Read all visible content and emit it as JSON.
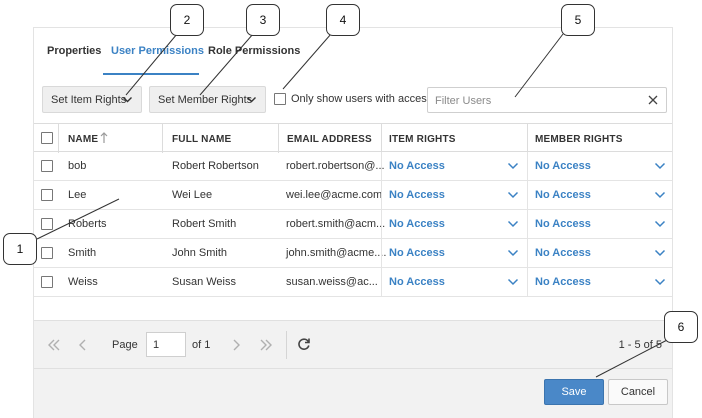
{
  "tabs": [
    {
      "label": "Properties"
    },
    {
      "label": "User Permissions"
    },
    {
      "label": "Role Permissions"
    }
  ],
  "toolbar": {
    "set_item_rights": "Set Item Rights",
    "set_member_rights": "Set Member Rights",
    "only_show_label": "Only show users with access",
    "filter_placeholder": "Filter Users"
  },
  "columns": {
    "name": "NAME",
    "full_name": "FULL NAME",
    "email": "EMAIL ADDRESS",
    "item_rights": "ITEM RIGHTS",
    "member_rights": "MEMBER RIGHTS"
  },
  "rows": [
    {
      "name": "bob",
      "full_name": "Robert Robertson",
      "email": "robert.robertson@...",
      "item_rights": "No Access",
      "member_rights": "No Access"
    },
    {
      "name": "Lee",
      "full_name": "Wei Lee",
      "email": "wei.lee@acme.com",
      "item_rights": "No Access",
      "member_rights": "No Access"
    },
    {
      "name": "Roberts",
      "full_name": "Robert Smith",
      "email": "robert.smith@acm...",
      "item_rights": "No Access",
      "member_rights": "No Access"
    },
    {
      "name": "Smith",
      "full_name": "John Smith",
      "email": "john.smith@acme....",
      "item_rights": "No Access",
      "member_rights": "No Access"
    },
    {
      "name": "Weiss",
      "full_name": "Susan Weiss",
      "email": "susan.weiss@ac...",
      "item_rights": "No Access",
      "member_rights": "No Access"
    }
  ],
  "pager": {
    "page_label": "Page",
    "page_value": "1",
    "of_label": "of 1",
    "range": "1 - 5 of 5"
  },
  "footer": {
    "save": "Save",
    "cancel": "Cancel"
  },
  "callouts": [
    "1",
    "2",
    "3",
    "4",
    "5",
    "6"
  ],
  "colors": {
    "accent": "#3b82c4",
    "save_button": "#4a88c8"
  }
}
